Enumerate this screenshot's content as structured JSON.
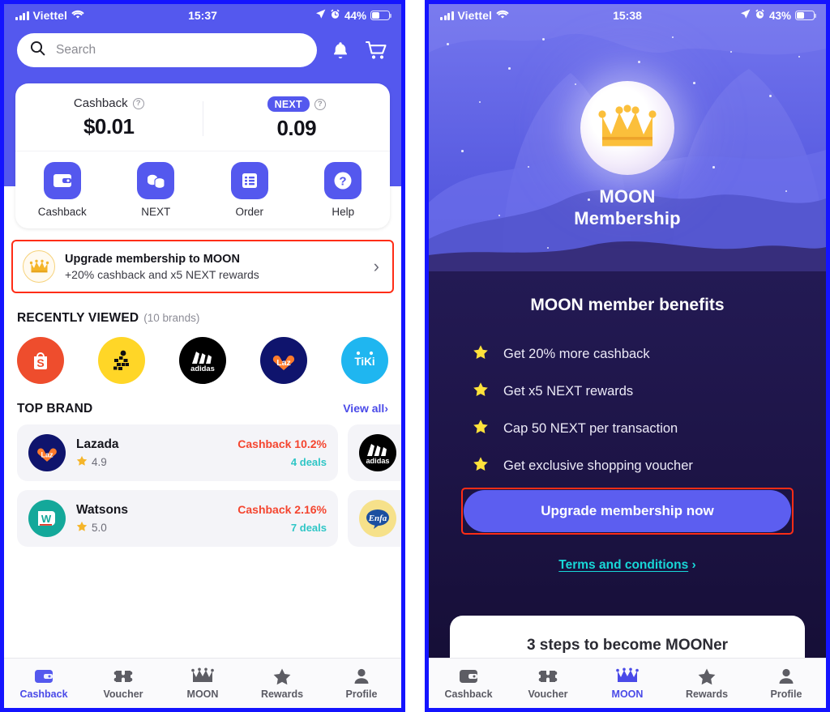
{
  "accent": {
    "brand_blue": "#5458ee",
    "frame_blue": "#1414ff",
    "highlight_red": "#ff2d16",
    "teal": "#18d7d7",
    "cashback_red": "#f4452f",
    "deal_teal": "#2fc6c6",
    "gold": "#f5b52a"
  },
  "left": {
    "status": {
      "carrier": "Viettel",
      "time": "15:37",
      "battery_pct": "44%"
    },
    "header": {
      "search_placeholder": "Search",
      "bell": "notification-bell",
      "cart": "shopping-cart"
    },
    "balance": {
      "cashback_label": "Cashback",
      "cashback_value": "$0.01",
      "next_label": "NEXT",
      "next_value": "0.09"
    },
    "quick_actions": [
      {
        "label": "Cashback",
        "icon": "wallet-icon"
      },
      {
        "label": "NEXT",
        "icon": "coins-icon"
      },
      {
        "label": "Order",
        "icon": "list-icon"
      },
      {
        "label": "Help",
        "icon": "question-icon"
      }
    ],
    "upsell": {
      "title": "Upgrade membership to MOON",
      "subtitle": "+20% cashback and x5 NEXT rewards",
      "chevron": "›"
    },
    "recently_viewed": {
      "title": "RECENTLY VIEWED",
      "count": "(10 brands)",
      "brands": [
        {
          "name": "Shopee",
          "short": "S"
        },
        {
          "name": "Be",
          "short": "be"
        },
        {
          "name": "adidas",
          "short": "adidas"
        },
        {
          "name": "Lazada",
          "short": "Laz"
        },
        {
          "name": "Tiki",
          "short": "TIKI"
        }
      ]
    },
    "top_brand": {
      "title": "TOP BRAND",
      "view_all": "View all",
      "view_all_chevron": "›",
      "rows": [
        {
          "name": "Lazada",
          "rating": "4.9",
          "cashback": "Cashback 10.2%",
          "deals": "4 deals",
          "peek": "adidas"
        },
        {
          "name": "Watsons",
          "rating": "5.0",
          "cashback": "Cashback 2.16%",
          "deals": "7 deals",
          "peek": "Enfa"
        }
      ]
    },
    "tabs": [
      {
        "label": "Cashback",
        "icon": "wallet-icon",
        "active": true
      },
      {
        "label": "Voucher",
        "icon": "voucher-icon",
        "active": false
      },
      {
        "label": "MOON",
        "icon": "crown-icon",
        "active": false
      },
      {
        "label": "Rewards",
        "icon": "star-icon",
        "active": false
      },
      {
        "label": "Profile",
        "icon": "person-icon",
        "active": false
      }
    ]
  },
  "right": {
    "status": {
      "carrier": "Viettel",
      "time": "15:38",
      "battery_pct": "43%"
    },
    "hero": {
      "title_line1": "MOON",
      "title_line2": "Membership",
      "icon": "crown-icon"
    },
    "benefits": {
      "title": "MOON member benefits",
      "items": [
        "Get 20% more cashback",
        "Get x5 NEXT rewards",
        "Cap 50 NEXT per transaction",
        "Get exclusive shopping voucher"
      ]
    },
    "cta": {
      "label": "Upgrade membership now"
    },
    "terms": {
      "label": "Terms and conditions",
      "chevron": "›"
    },
    "steps_card": {
      "title": "3 steps to become MOONer"
    },
    "tabs": [
      {
        "label": "Cashback",
        "icon": "wallet-icon",
        "active": false
      },
      {
        "label": "Voucher",
        "icon": "voucher-icon",
        "active": false
      },
      {
        "label": "MOON",
        "icon": "crown-icon",
        "active": true
      },
      {
        "label": "Rewards",
        "icon": "star-icon",
        "active": false
      },
      {
        "label": "Profile",
        "icon": "person-icon",
        "active": false
      }
    ]
  }
}
